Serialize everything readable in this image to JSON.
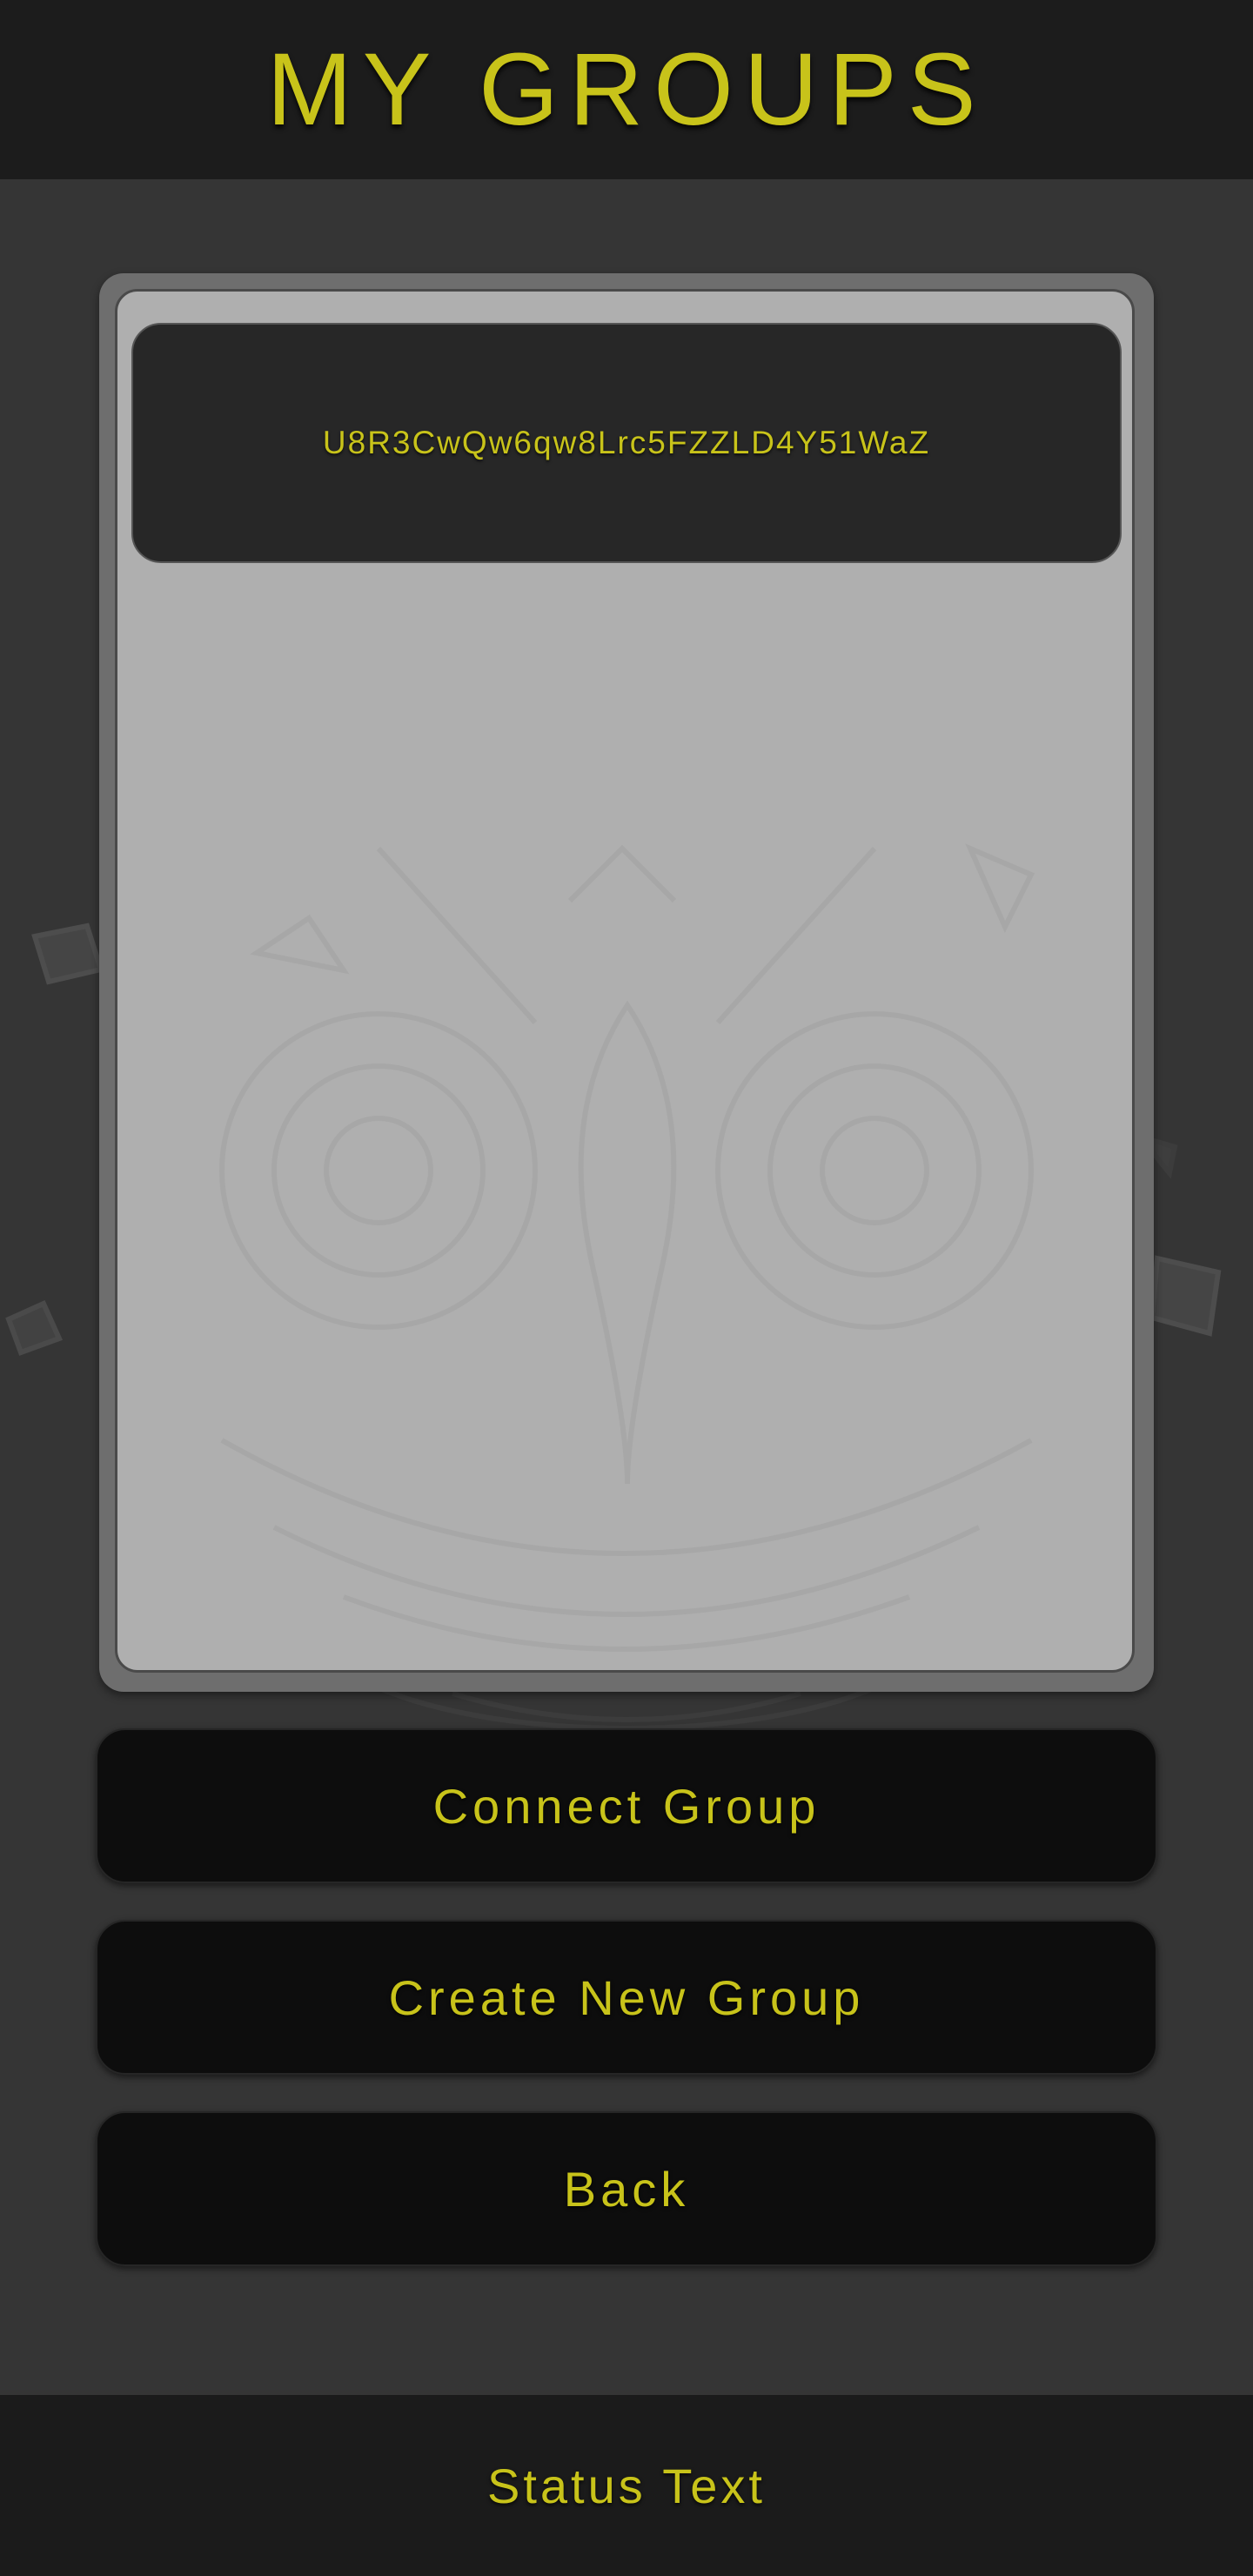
{
  "header": {
    "title": "MY GROUPS"
  },
  "groups": {
    "items": [
      {
        "id_label": "U8R3CwQw6qw8Lrc5FZZLD4Y51WaZ"
      }
    ]
  },
  "actions": {
    "connect_label": "Connect Group",
    "create_label": "Create New Group",
    "back_label": "Back"
  },
  "footer": {
    "status": "Status Text"
  },
  "colors": {
    "accent": "#c8c31a",
    "header_bg": "#1c1c1c",
    "body_bg": "#353535",
    "button_bg": "#0d0d0d",
    "panel_bg": "#b4b4b4",
    "item_bg": "#272727"
  }
}
